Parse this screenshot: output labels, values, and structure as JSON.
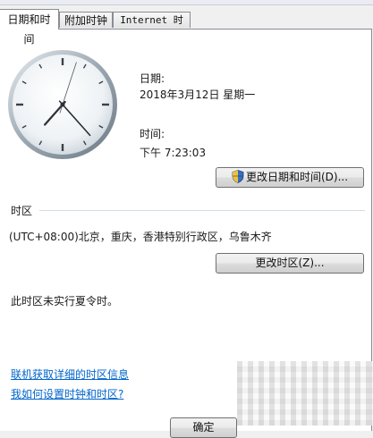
{
  "tabs": [
    {
      "label": "日期和时间"
    },
    {
      "label": "附加时钟"
    },
    {
      "label": "Internet 时间"
    }
  ],
  "date": {
    "label": "日期:",
    "value": "2018年3月12日 星期一"
  },
  "time": {
    "label": "时间:",
    "value": "下午 7:23:03"
  },
  "buttons": {
    "change_datetime": "更改日期和时间(D)...",
    "change_timezone": "更改时区(Z)...",
    "ok": "确定"
  },
  "timezone": {
    "group_label": "时区",
    "value": "(UTC+08:00)北京，重庆，香港特别行政区，乌鲁木齐",
    "dst_note": "此时区未实行夏令时。"
  },
  "links": {
    "online_tz_info": "联机获取详细的时区信息",
    "how_to_set": "我如何设置时钟和时区?"
  },
  "clock": {
    "hours": 7,
    "minutes": 23,
    "seconds": 3
  },
  "colors": {
    "link": "#0066cc",
    "window_bg": "#f0f0f0",
    "panel_bg": "#ffffff"
  }
}
